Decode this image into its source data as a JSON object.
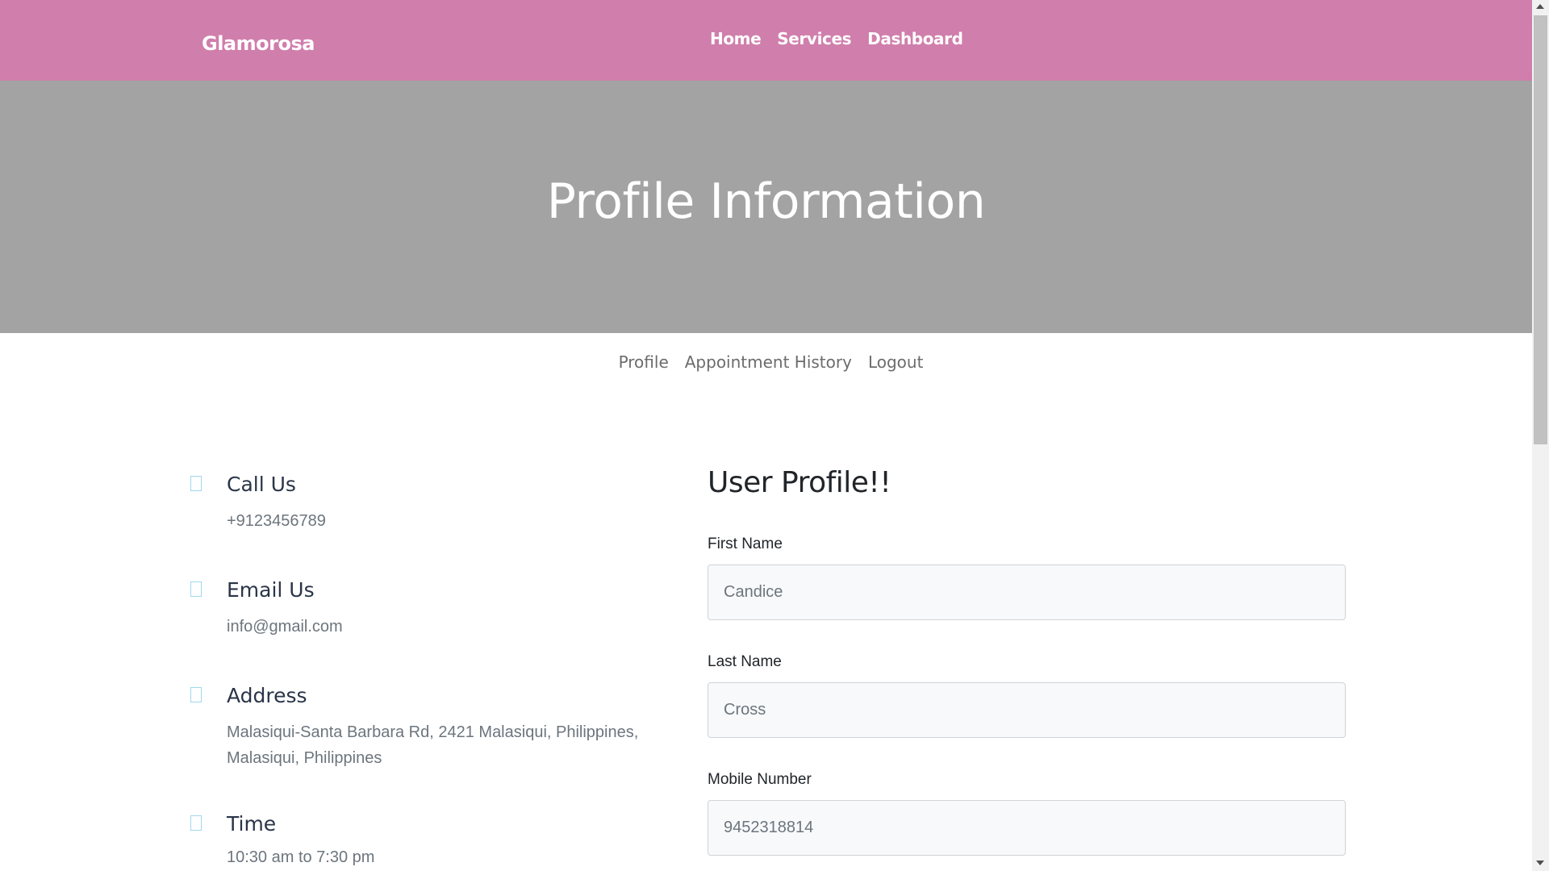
{
  "navbar": {
    "brand": "Glamorosa",
    "links": [
      "Home",
      "Services",
      "Dashboard"
    ],
    "background": "#d07eac"
  },
  "hero": {
    "title": "Profile Information",
    "background": "#a3a3a3"
  },
  "subnav": {
    "links": [
      "Profile",
      "Appointment History",
      "Logout"
    ]
  },
  "contact": [
    {
      "title": "Call Us",
      "text": "+9123456789"
    },
    {
      "title": "Email Us",
      "text": "info@gmail.com"
    },
    {
      "title": "Address",
      "text": "Malasiqui-Santa Barbara Rd, 2421 Malasiqui, Philippines, Malasiqui, Philippines"
    },
    {
      "title": "Time",
      "text": "10:30 am to 7:30 pm"
    }
  ],
  "profile_form": {
    "title": "User Profile!!",
    "fields": [
      {
        "label": "First Name",
        "value": "Candice"
      },
      {
        "label": "Last Name",
        "value": "Cross"
      },
      {
        "label": "Mobile Number",
        "value": "9452318814"
      }
    ]
  }
}
